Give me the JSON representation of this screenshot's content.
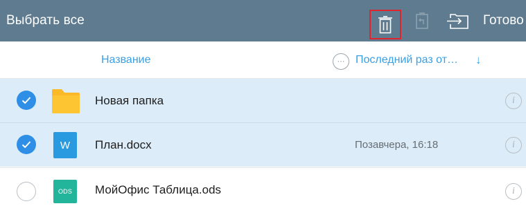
{
  "toolbar": {
    "select_all": "Выбрать все",
    "done": "Готово",
    "icons": [
      "trash-icon",
      "restore-icon",
      "move-to-folder-icon"
    ],
    "highlight_color": "#e0242b",
    "background_color": "#5f7b8f"
  },
  "header": {
    "name_label": "Название",
    "more_label": "···",
    "date_label": "Последний раз от…",
    "sort_arrow": "↓",
    "accent_color": "#3a9fe3"
  },
  "files": [
    {
      "name": "Новая папка",
      "date": "",
      "selected": true,
      "type": "folder",
      "icon": "folder-icon"
    },
    {
      "name": "План.docx",
      "date": "Позавчера, 16:18",
      "selected": true,
      "type": "document",
      "icon_label": "W",
      "icon": "word-document-icon"
    },
    {
      "name": "МойОфис Таблица.ods",
      "date": "",
      "selected": false,
      "type": "spreadsheet",
      "icon_label": "ODS",
      "icon": "spreadsheet-icon"
    }
  ],
  "info_glyph": "i"
}
